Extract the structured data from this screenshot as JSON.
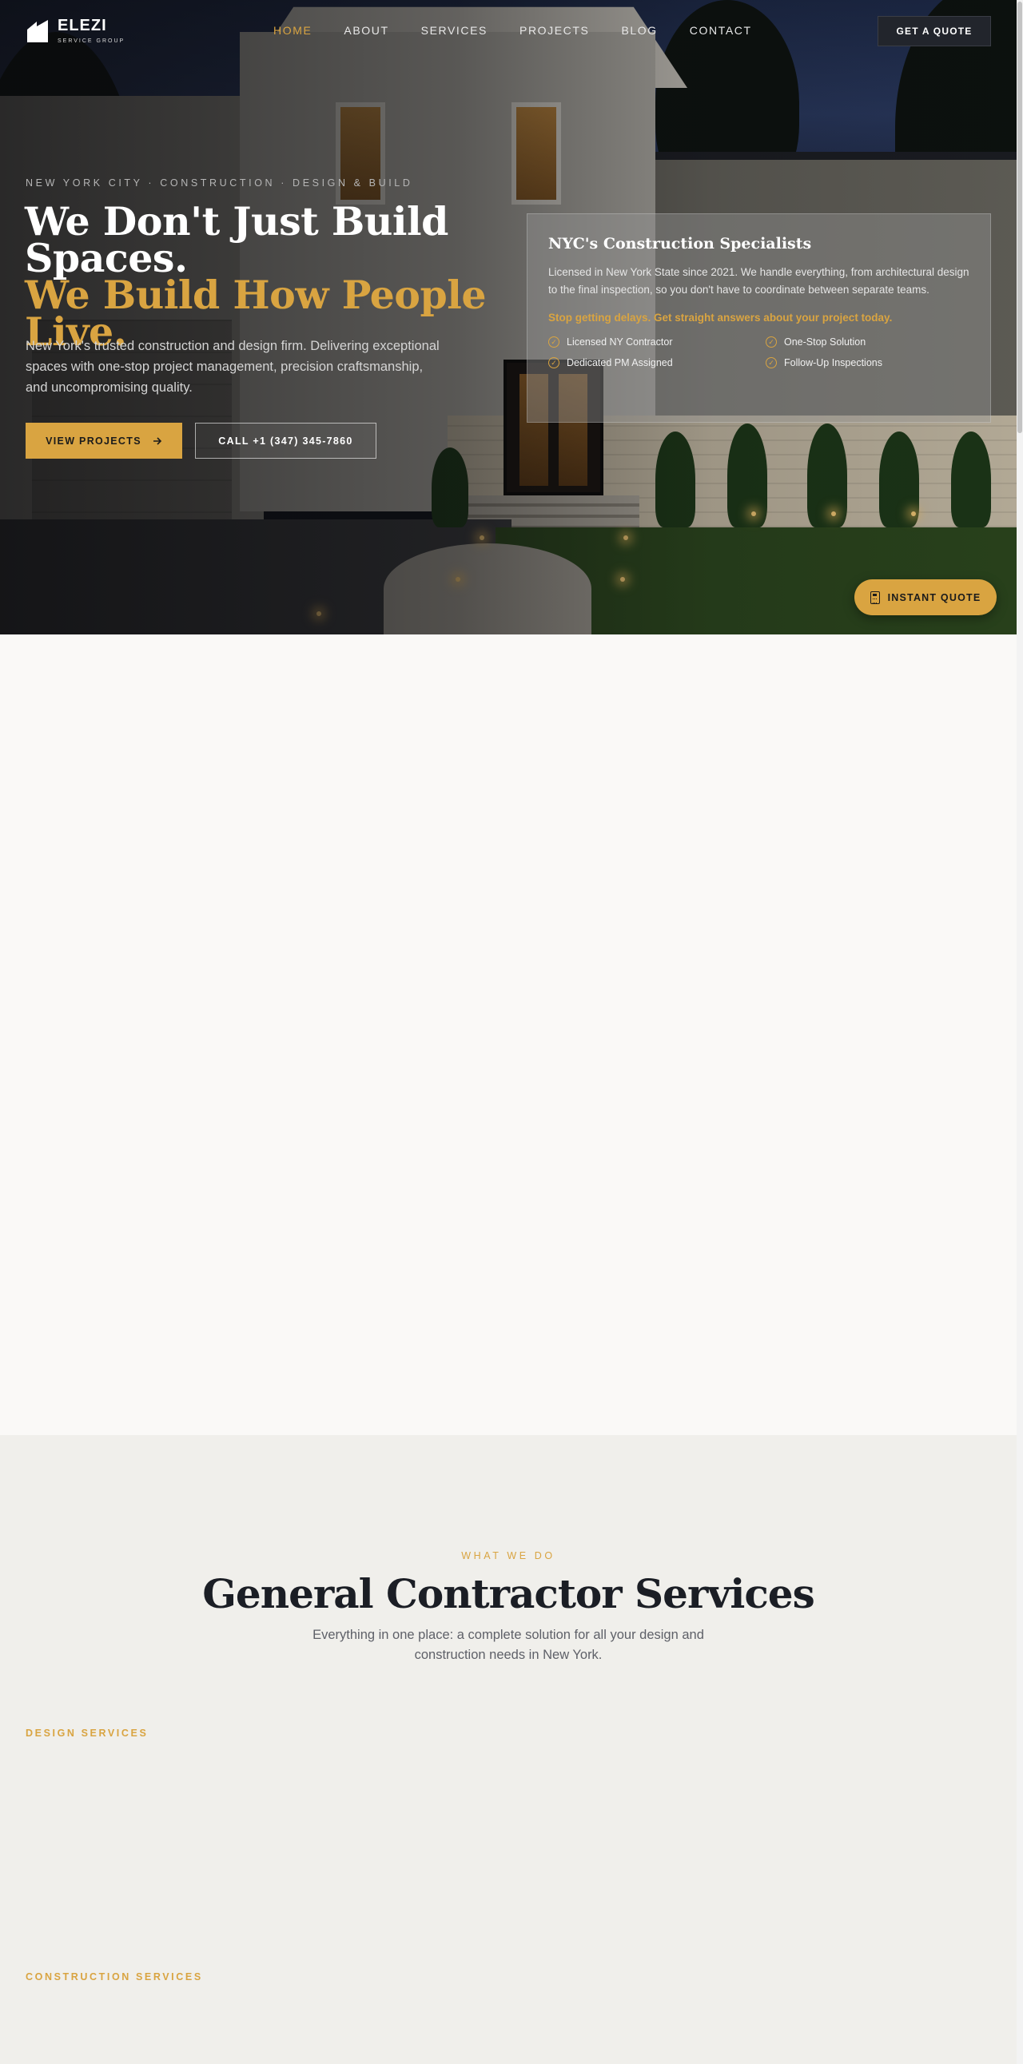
{
  "brand": {
    "name": "ELEZI",
    "tagline": "SERVICE GROUP"
  },
  "nav": {
    "items": [
      {
        "label": "HOME",
        "active": true
      },
      {
        "label": "ABOUT"
      },
      {
        "label": "SERVICES"
      },
      {
        "label": "PROJECTS"
      },
      {
        "label": "BLOG"
      },
      {
        "label": "CONTACT"
      }
    ],
    "cta_label": "GET A QUOTE"
  },
  "hero": {
    "eyebrow": "NEW YORK CITY · CONSTRUCTION · DESIGN & BUILD",
    "title_line1": "We Don't Just Build",
    "title_line2": "Spaces.",
    "title_accent": "We Build How People Live.",
    "description": "New York's trusted construction and design firm. Delivering exceptional spaces with one-stop project management, precision craftsmanship, and uncompromising quality.",
    "primary_button": "VIEW PROJECTS",
    "secondary_button": "CALL +1 (347) 345-7860"
  },
  "card": {
    "title": "NYC's Construction Specialists",
    "text": "Licensed in New York State since 2021. We handle everything, from architectural design to the final inspection, so you don't have to coordinate between separate teams.",
    "cta": "Stop getting delays. Get straight answers about your project today.",
    "checks": [
      "Licensed NY Contractor",
      "One-Stop Solution",
      "Dedicated PM Assigned",
      "Follow-Up Inspections"
    ]
  },
  "floating_button": {
    "label": "INSTANT QUOTE",
    "icon": "calculator-icon"
  },
  "services": {
    "eyebrow": "WHAT WE DO",
    "title": "General Contractor Services",
    "description": "Everything in one place: a complete solution for all your design and construction needs in New York.",
    "categories": [
      "DESIGN SERVICES",
      "CONSTRUCTION SERVICES"
    ]
  },
  "colors": {
    "accent": "#d9a441",
    "dark": "#1b1e25",
    "services_bg": "#f0efeb",
    "page_bg": "#faf9f7"
  }
}
